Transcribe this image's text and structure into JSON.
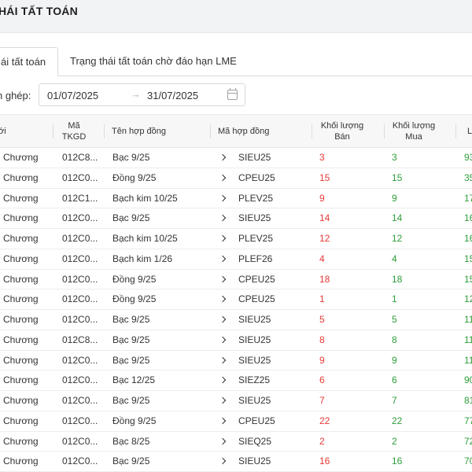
{
  "page": {
    "title": "HÁI TẤT TOÁN"
  },
  "tabs": [
    {
      "label": "ái tất toán",
      "active": true
    },
    {
      "label": "Trạng thái tất toán chờ đáo hạn LME",
      "active": false
    }
  ],
  "filter": {
    "label": "n ghép:",
    "from": "01/07/2025",
    "arrow": "→",
    "to": "31/07/2025"
  },
  "table": {
    "headers": {
      "name": "ới",
      "tkgd": "Mã\nTKGD",
      "contract_name": "Tên hợp đồng",
      "contract_code": "Mã hợp đồng",
      "sell_qty": "Khối lượng\nBán",
      "buy_qty": "Khối lượng\nMua",
      "last": "L"
    },
    "rows": [
      {
        "name": "Chương",
        "tkgd": "012C8...",
        "contract": "Bạc 9/25",
        "code": "SIEU25",
        "sell": "3",
        "buy": "3",
        "last": "93"
      },
      {
        "name": "Chương",
        "tkgd": "012C0...",
        "contract": "Đồng 9/25",
        "code": "CPEU25",
        "sell": "15",
        "buy": "15",
        "last": "35"
      },
      {
        "name": "Chương",
        "tkgd": "012C1...",
        "contract": "Bạch kim 10/25",
        "code": "PLEV25",
        "sell": "9",
        "buy": "9",
        "last": "17"
      },
      {
        "name": "Chương",
        "tkgd": "012C0...",
        "contract": "Bạc 9/25",
        "code": "SIEU25",
        "sell": "14",
        "buy": "14",
        "last": "16"
      },
      {
        "name": "Chương",
        "tkgd": "012C0...",
        "contract": "Bạch kim 10/25",
        "code": "PLEV25",
        "sell": "12",
        "buy": "12",
        "last": "16"
      },
      {
        "name": "Chương",
        "tkgd": "012C0...",
        "contract": "Bạch kim 1/26",
        "code": "PLEF26",
        "sell": "4",
        "buy": "4",
        "last": "15"
      },
      {
        "name": "Chương",
        "tkgd": "012C0...",
        "contract": "Đồng 9/25",
        "code": "CPEU25",
        "sell": "18",
        "buy": "18",
        "last": "15"
      },
      {
        "name": "Chương",
        "tkgd": "012C0...",
        "contract": "Đồng 9/25",
        "code": "CPEU25",
        "sell": "1",
        "buy": "1",
        "last": "12"
      },
      {
        "name": "Chương",
        "tkgd": "012C0...",
        "contract": "Bạc 9/25",
        "code": "SIEU25",
        "sell": "5",
        "buy": "5",
        "last": "11"
      },
      {
        "name": "Chương",
        "tkgd": "012C8...",
        "contract": "Bạc 9/25",
        "code": "SIEU25",
        "sell": "8",
        "buy": "8",
        "last": "11"
      },
      {
        "name": "Chương",
        "tkgd": "012C0...",
        "contract": "Bạc 9/25",
        "code": "SIEU25",
        "sell": "9",
        "buy": "9",
        "last": "11"
      },
      {
        "name": "Chương",
        "tkgd": "012C0...",
        "contract": "Bạc 12/25",
        "code": "SIEZ25",
        "sell": "6",
        "buy": "6",
        "last": "90"
      },
      {
        "name": "Chương",
        "tkgd": "012C0...",
        "contract": "Bạc 9/25",
        "code": "SIEU25",
        "sell": "7",
        "buy": "7",
        "last": "81"
      },
      {
        "name": "Chương",
        "tkgd": "012C0...",
        "contract": "Đồng 9/25",
        "code": "CPEU25",
        "sell": "22",
        "buy": "22",
        "last": "77"
      },
      {
        "name": "Chương",
        "tkgd": "012C0...",
        "contract": "Bạc 8/25",
        "code": "SIEQ25",
        "sell": "2",
        "buy": "2",
        "last": "72"
      },
      {
        "name": "Chương",
        "tkgd": "012C0...",
        "contract": "Bạc 9/25",
        "code": "SIEU25",
        "sell": "16",
        "buy": "16",
        "last": "70"
      }
    ]
  },
  "colors": {
    "sell": "#e53935",
    "buy": "#2e9e3a",
    "header_bg": "#f7f7f7",
    "topbar_bg": "#f2f3f5"
  }
}
